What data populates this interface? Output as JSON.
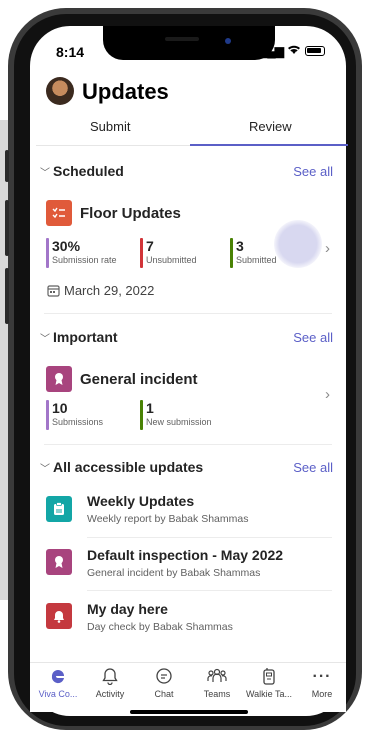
{
  "status": {
    "time": "8:14"
  },
  "header": {
    "title": "Updates"
  },
  "tabs": [
    {
      "label": "Submit"
    },
    {
      "label": "Review"
    }
  ],
  "scheduled": {
    "title": "Scheduled",
    "see_all": "See all",
    "card": {
      "title": "Floor Updates",
      "icon": "checklist-icon",
      "color": "#e05a3a",
      "stats": [
        {
          "value": "30%",
          "label": "Submission rate",
          "color": "#a276c9"
        },
        {
          "value": "7",
          "label": "Unsubmitted",
          "color": "#d13438"
        },
        {
          "value": "3",
          "label": "Submitted",
          "color": "#498205"
        }
      ],
      "date": "March 29, 2022"
    }
  },
  "important": {
    "title": "Important",
    "see_all": "See all",
    "card": {
      "title": "General incident",
      "icon": "badge-icon",
      "color": "#a8447e",
      "stats": [
        {
          "value": "10",
          "label": "Submissions",
          "color": "#a276c9"
        },
        {
          "value": "1",
          "label": "New submission",
          "color": "#498205"
        }
      ]
    }
  },
  "accessible": {
    "title": "All accessible updates",
    "see_all": "See all",
    "items": [
      {
        "title": "Weekly Updates",
        "subtitle": "Weekly report by Babak Shammas",
        "icon": "clipboard-icon",
        "color": "#13a6a6"
      },
      {
        "title": "Default inspection - May 2022",
        "subtitle": "General incident by Babak Shammas",
        "icon": "badge-icon",
        "color": "#a8447e"
      },
      {
        "title": "My day here",
        "subtitle": "Day check by Babak Shammas",
        "icon": "bell-icon",
        "color": "#c4393f"
      }
    ]
  },
  "nav": [
    {
      "label": "Viva Co...",
      "icon": "viva-icon"
    },
    {
      "label": "Activity",
      "icon": "bell-icon"
    },
    {
      "label": "Chat",
      "icon": "chat-icon"
    },
    {
      "label": "Teams",
      "icon": "teams-icon"
    },
    {
      "label": "Walkie Ta...",
      "icon": "walkie-talkie-icon"
    },
    {
      "label": "More",
      "icon": "more-icon"
    }
  ],
  "colors": {
    "accent": "#5b5fc7"
  }
}
